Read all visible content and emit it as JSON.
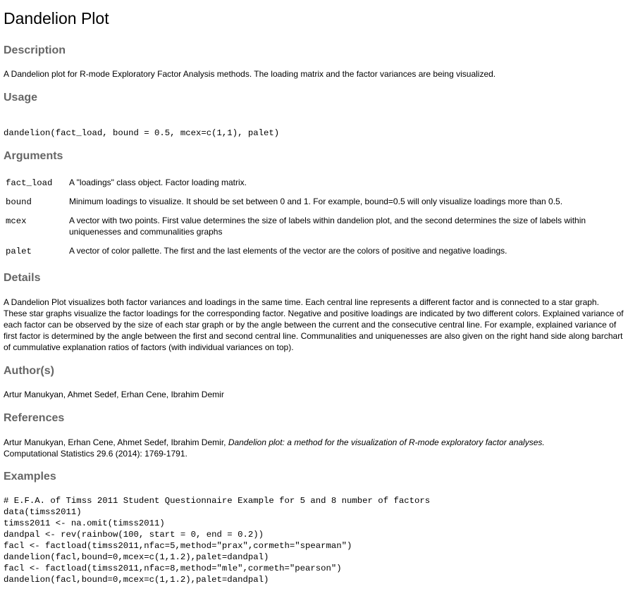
{
  "title": "Dandelion Plot",
  "description": {
    "heading": "Description",
    "text": "A Dandelion plot for R-mode Exploratory Factor Analysis methods. The loading matrix and the factor variances are being visualized."
  },
  "usage": {
    "heading": "Usage",
    "code": "dandelion(fact_load, bound = 0.5, mcex=c(1,1), palet)"
  },
  "arguments": {
    "heading": "Arguments",
    "items": [
      {
        "name": "fact_load",
        "desc": "A \"loadings\" class object. Factor loading matrix."
      },
      {
        "name": "bound",
        "desc": "Minimum loadings to visualize. It should be set between 0 and 1. For example, bound=0.5 will only visualize loadings more than 0.5."
      },
      {
        "name": "mcex",
        "desc": "A vector with two points. First value determines the size of labels within dandelion plot, and the second determines the size of labels within uniquenesses and communalities graphs"
      },
      {
        "name": "palet",
        "desc": "A vector of color pallette. The first and the last elements of the vector are the colors of positive and negative loadings."
      }
    ]
  },
  "details": {
    "heading": "Details",
    "text": "A Dandelion Plot visualizes both factor variances and loadings in the same time. Each central line represents a different factor and is connected to a star graph. These star graphs visualize the factor loadings for the corresponding factor. Negative and positive loadings are indicated by two different colors. Explained variance of each factor can be observed by the size of each star graph or by the angle between the current and the consecutive central line. For example, explained variance of first factor is determined by the angle between the first and second central line. Communalities and uniquenesses are also given on the right hand side along barchart of cummulative explanation ratios of factors (with individual variances on top)."
  },
  "authors": {
    "heading": "Author(s)",
    "text": "Artur Manukyan, Ahmet Sedef, Erhan Cene, Ibrahim Demir"
  },
  "references": {
    "heading": "References",
    "authors": "Artur Manukyan, Erhan Cene, Ahmet Sedef, Ibrahim Demir,",
    "title": "Dandelion plot: a method for the visualization of R-mode exploratory factor analyses.",
    "journal": "Computational Statistics 29.6 (2014): 1769-1791."
  },
  "examples": {
    "heading": "Examples",
    "code": "# E.F.A. of Timss 2011 Student Questionnaire Example for 5 and 8 number of factors\ndata(timss2011)\ntimss2011 <- na.omit(timss2011)\ndandpal <- rev(rainbow(100, start = 0, end = 0.2))\nfacl <- factload(timss2011,nfac=5,method=\"prax\",cormeth=\"spearman\")\ndandelion(facl,bound=0,mcex=c(1,1.2),palet=dandpal)\nfacl <- factload(timss2011,nfac=8,method=\"mle\",cormeth=\"pearson\")\ndandelion(facl,bound=0,mcex=c(1,1.2),palet=dandpal)"
  }
}
